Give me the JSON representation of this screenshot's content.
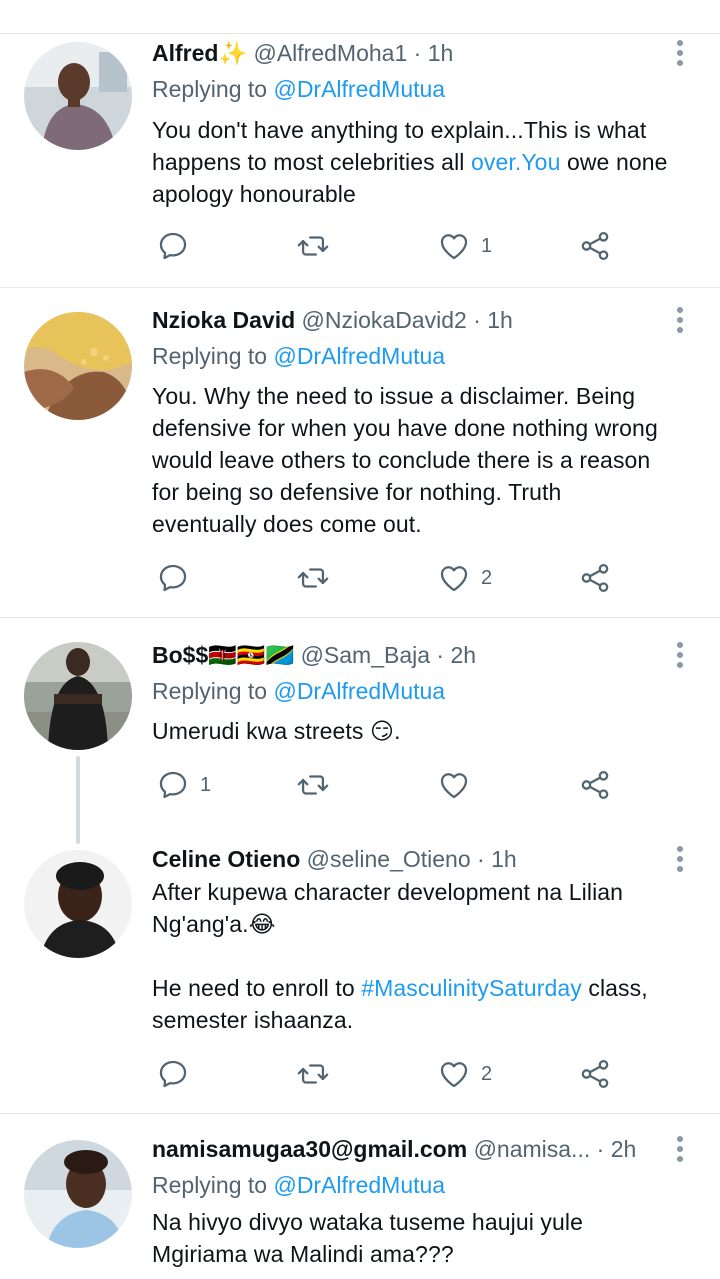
{
  "tweets": [
    {
      "name": "Alfred",
      "name_emoji": "✨",
      "handle": "@AlfredMoha1",
      "dot": "·",
      "time": "1h",
      "replying_label": "Replying to",
      "replying_to": "@DrAlfredMutua",
      "text_lines": [
        "You don't have anything to explain...This is what",
        "happens to most celebrities all ",
        "apology honourable"
      ],
      "link_text": "over.You",
      "line2_after_link": " owe none",
      "reply_count": "",
      "retweet_count": "",
      "like_count": "1"
    },
    {
      "name": "Nzioka David",
      "handle": "@NziokaDavid2",
      "dot": "·",
      "time": "1h",
      "replying_label": "Replying to",
      "replying_to": "@DrAlfredMutua",
      "text_lines": [
        "You.  Why the need to issue a disclaimer. Being",
        "defensive for when you have done nothing wrong",
        "would leave others to conclude there is a reason",
        "for being so defensive for nothing.  Truth",
        "eventually does come out."
      ],
      "reply_count": "",
      "retweet_count": "",
      "like_count": "2"
    },
    {
      "name": "Bo$$",
      "name_emoji": "🇰🇪🇺🇬🇹🇿",
      "handle": "@Sam_Baja",
      "dot": "·",
      "time": "2h",
      "replying_label": "Replying to",
      "replying_to": "@DrAlfredMutua",
      "text": "Umerudi kwa streets 😏.",
      "reply_count": "1",
      "retweet_count": "",
      "like_count": ""
    },
    {
      "name": "Celine Otieno",
      "handle": "@seline_Otieno",
      "dot": "·",
      "time": "1h",
      "text_line1": "After kupewa character development na Lilian",
      "text_line2": "Ng'ang'a.😂",
      "text_line3_before": "He need to enroll to ",
      "hashtag": "#MasculinitySaturday",
      "text_line3_after": " class,",
      "text_line4": "semester ishaanza.",
      "reply_count": "",
      "retweet_count": "",
      "like_count": "2"
    },
    {
      "name": "namisamugaa30@gmail.com",
      "handle": "@namisa...",
      "dot": "·",
      "time": "2h",
      "replying_label": "Replying to",
      "replying_to": "@DrAlfredMutua",
      "text_lines": [
        "Na hivyo divyo wataka tuseme haujui yule",
        "Mgiriama  wa Malindi ama???"
      ]
    }
  ],
  "colors": {
    "link": "#1d9bf0",
    "secondary": "#536471",
    "divider": "#e6e8ea",
    "thread_line": "#cfd9de"
  },
  "icons": [
    "reply-icon",
    "retweet-icon",
    "like-icon",
    "share-icon",
    "more-options-icon"
  ]
}
